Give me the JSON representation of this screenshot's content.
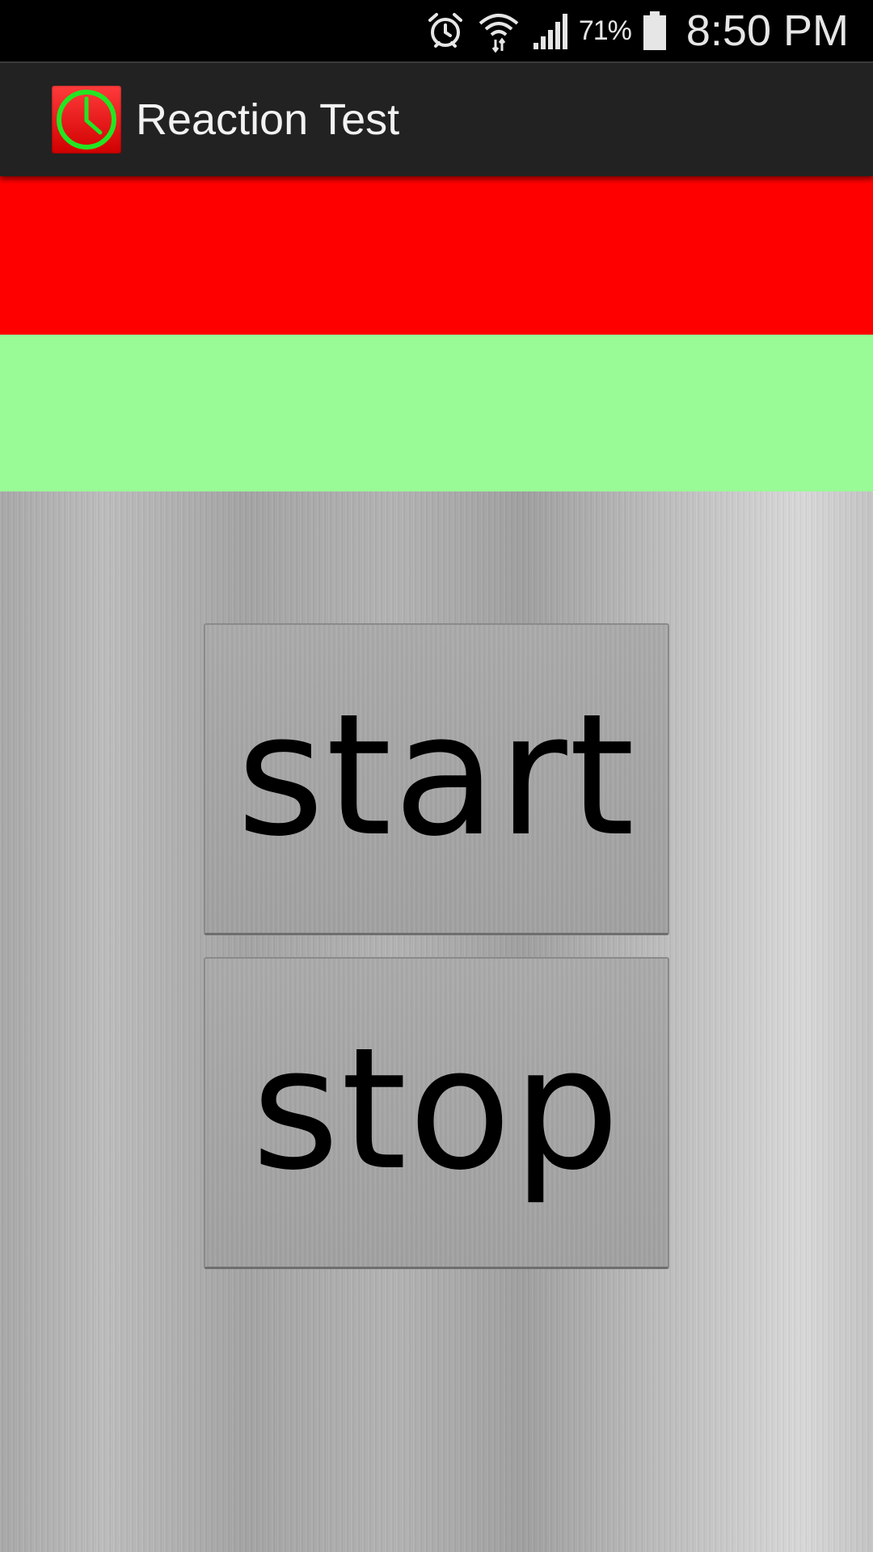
{
  "status_bar": {
    "battery_percent": "71%",
    "time": "8:50 PM",
    "icons": [
      "alarm-icon",
      "wifi-icon",
      "signal-icon",
      "battery-icon"
    ]
  },
  "action_bar": {
    "title": "Reaction Test",
    "icon": "clock-icon"
  },
  "panels": {
    "top_color": "#ff0000",
    "bottom_color": "#99fb96"
  },
  "buttons": {
    "start_label": "start",
    "stop_label": "stop"
  }
}
